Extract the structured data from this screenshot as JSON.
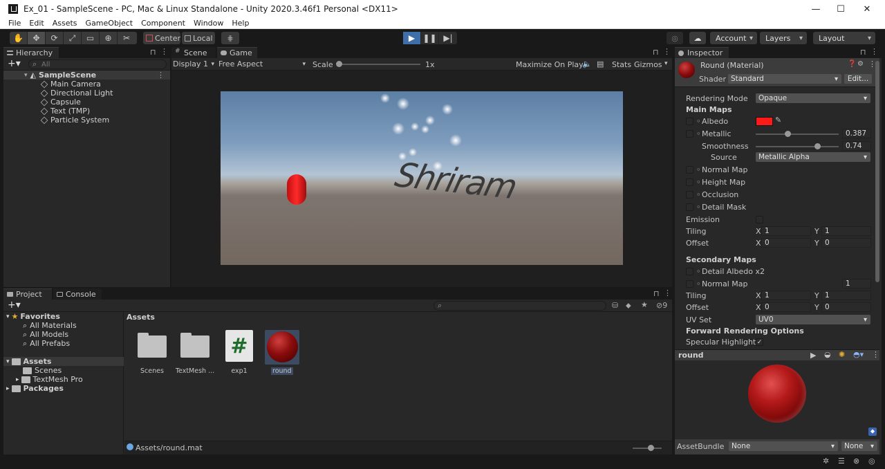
{
  "window": {
    "title": "Ex_01 - SampleScene - PC, Mac & Linux Standalone - Unity 2020.3.46f1 Personal <DX11>"
  },
  "menu": [
    "File",
    "Edit",
    "Assets",
    "GameObject",
    "Component",
    "Window",
    "Help"
  ],
  "toolbar": {
    "pivot": "Center",
    "space": "Local",
    "account": "Account",
    "layers": "Layers",
    "layout": "Layout"
  },
  "hierarchy": {
    "tab": "Hierarchy",
    "search_placeholder": "All",
    "scene": "SampleScene",
    "items": [
      "Main Camera",
      "Directional Light",
      "Capsule",
      "Text (TMP)",
      "Particle System"
    ]
  },
  "game": {
    "tab_scene": "Scene",
    "tab_game": "Game",
    "display": "Display 1",
    "aspect": "Free Aspect",
    "scale_label": "Scale",
    "scale_value": "1x",
    "maximize": "Maximize On Play",
    "stats": "Stats",
    "gizmos": "Gizmos",
    "world_text": "Shriram"
  },
  "project": {
    "tab_project": "Project",
    "tab_console": "Console",
    "favorites_label": "Favorites",
    "favorites": [
      "All Materials",
      "All Models",
      "All Prefabs"
    ],
    "assets_label": "Assets",
    "asset_folders": [
      "Scenes",
      "TextMesh Pro"
    ],
    "packages_label": "Packages",
    "breadcrumb": "Assets",
    "tiles": [
      "Scenes",
      "TextMesh ...",
      "exp1",
      "round"
    ],
    "script_glyph": "#",
    "hidden_count": "9",
    "status_path": "Assets/round.mat"
  },
  "inspector": {
    "tab": "Inspector",
    "material_name": "Round (Material)",
    "shader_label": "Shader",
    "shader_value": "Standard",
    "edit_btn": "Edit...",
    "rendering_mode_label": "Rendering Mode",
    "rendering_mode": "Opaque",
    "main_maps": "Main Maps",
    "albedo": "Albedo",
    "albedo_color": "#ff1a1a",
    "metallic": "Metallic",
    "metallic_value": "0.387",
    "smoothness": "Smoothness",
    "smoothness_value": "0.74",
    "source": "Source",
    "source_value": "Metallic Alpha",
    "normal_map": "Normal Map",
    "height_map": "Height Map",
    "occlusion": "Occlusion",
    "detail_mask": "Detail Mask",
    "emission": "Emission",
    "tiling": "Tiling",
    "offset": "Offset",
    "x_label": "X",
    "y_label": "Y",
    "tiling_x": "1",
    "tiling_y": "1",
    "offset_x": "0",
    "offset_y": "0",
    "secondary_maps": "Secondary Maps",
    "detail_albedo": "Detail Albedo x2",
    "normal_map2": "Normal Map",
    "normal_map2_value": "1",
    "tiling2_x": "1",
    "tiling2_y": "1",
    "offset2_x": "0",
    "offset2_y": "0",
    "uv_set": "UV Set",
    "uv_set_value": "UV0",
    "forward_options": "Forward Rendering Options",
    "specular_highlights": "Specular Highlights",
    "check_glyph": "✓",
    "preview_name": "round",
    "assetbundle_label": "AssetBundle",
    "assetbundle_value": "None",
    "assetbundle_variant": "None"
  }
}
